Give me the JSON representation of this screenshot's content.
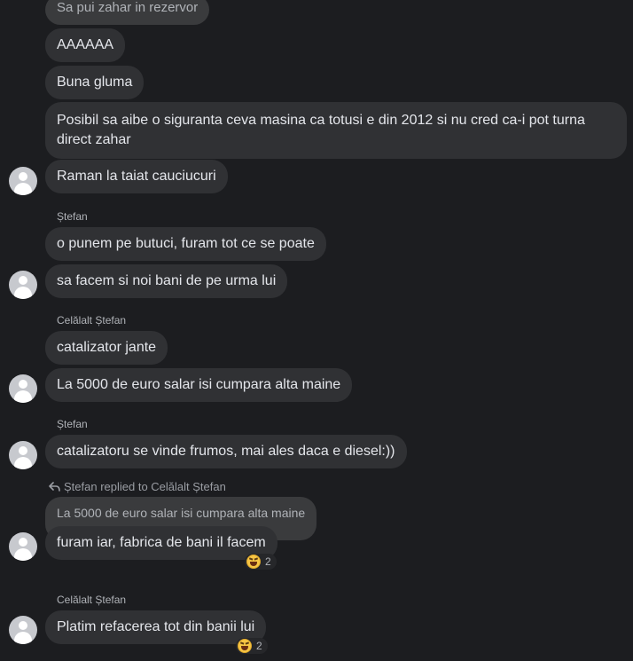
{
  "messages": {
    "m1": "Sa pui zahar in rezervor",
    "m2": "AAAAAA",
    "m3": "Buna gluma",
    "m4": "Posibil sa aibe o siguranta ceva masina ca totusi e din 2012 si nu cred ca-i pot turna direct zahar",
    "m5": "Raman la taiat cauciucuri",
    "m6": "o punem pe butuci, furam tot ce se poate",
    "m7": "sa facem si noi bani de pe urma lui",
    "m8": "catalizator jante",
    "m9": "La 5000 de euro salar isi cumpara alta maine",
    "m10": "catalizatoru se vinde frumos, mai ales daca e diesel:))",
    "m11_quote": "La 5000 de euro salar isi cumpara alta maine",
    "m11": "furam iar, fabrica de bani il facem",
    "m12": "Platim refacerea tot din banii lui"
  },
  "senders": {
    "s1": "Ștefan",
    "s2": "Celălalt Ștefan",
    "s3": "Ștefan",
    "s4": "Celălalt Ștefan"
  },
  "reply_note": "Ștefan replied to Celălalt Ștefan",
  "reactions": {
    "r1": {
      "emoji": "laughing-face",
      "count": "2"
    },
    "r2": {
      "emoji": "laughing-face",
      "count": "2"
    }
  },
  "colors": {
    "background": "#1c1d20",
    "bubble": "#303134",
    "text": "#e4e6eb",
    "secondary_text": "#b0b3b8"
  }
}
